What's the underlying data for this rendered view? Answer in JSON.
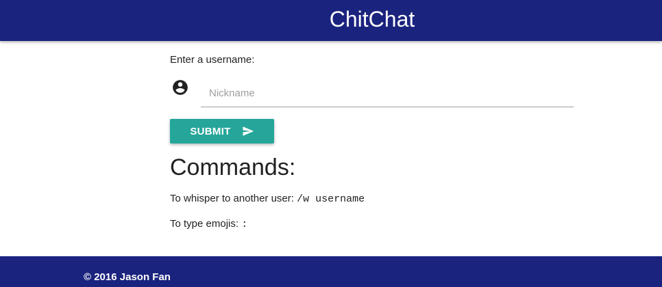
{
  "header": {
    "brand": "ChitChat",
    "background_color": "#1a237e"
  },
  "form": {
    "prompt": "Enter a username:",
    "account_icon": "account-circle-icon",
    "nickname_placeholder": "Nickname",
    "nickname_value": "",
    "submit_label": "SUBMIT",
    "submit_icon": "send-icon",
    "submit_color": "#26a69a"
  },
  "commands": {
    "heading": "Commands:",
    "whisper_text": "To whisper to another user:",
    "whisper_code": "/w username",
    "emoji_text": "To type emojis:",
    "emoji_code": ":"
  },
  "footer": {
    "copyright": "© 2016 Jason Fan",
    "background_color": "#1a237e"
  }
}
